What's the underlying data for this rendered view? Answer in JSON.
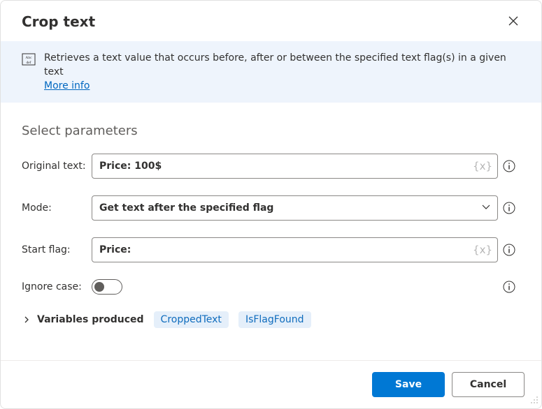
{
  "header": {
    "title": "Crop text"
  },
  "banner": {
    "text": "Retrieves a text value that occurs before, after or between the specified text flag(s) in a given text",
    "link_label": "More info"
  },
  "section": {
    "title": "Select parameters"
  },
  "fields": {
    "original_text": {
      "label": "Original text:",
      "value": "Price: 100$"
    },
    "mode": {
      "label": "Mode:",
      "value": "Get text after the specified flag"
    },
    "start_flag": {
      "label": "Start flag:",
      "value": "Price:"
    },
    "ignore_case": {
      "label": "Ignore case:",
      "on": false
    }
  },
  "vars": {
    "label": "Variables produced",
    "items": [
      "CroppedText",
      "IsFlagFound"
    ]
  },
  "footer": {
    "save": "Save",
    "cancel": "Cancel"
  }
}
